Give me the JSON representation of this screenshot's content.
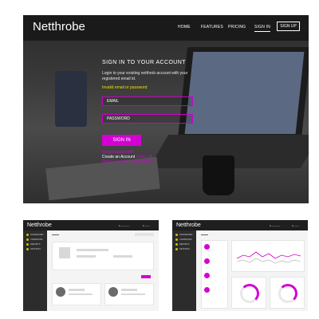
{
  "hero": {
    "brand": "Netthrobe",
    "nav": {
      "home": "HOME",
      "features": "FEATURES",
      "pricing": "PRICING",
      "sign_in": "SIGN IN",
      "sign_up": "SIGN UP"
    },
    "form": {
      "title": "SIGN IN TO YOUR ACCOUNT",
      "subtitle": "Login to your existing netthrob account with your registered email id.",
      "error": "Invalid email or password",
      "email_placeholder": "EMAIL",
      "password_placeholder": "PASSWORD",
      "sign_in_button": "SIGN IN",
      "forgot": "Forgot password?",
      "create_account": "Create an Account",
      "sign_up_link": "SIGN UP",
      "resend": "Didn't Receive confirmation?"
    }
  },
  "thumb1": {
    "brand": "Netthrobe",
    "sidebar": [
      "DASHBOARD",
      "CAMPAIGNS",
      "REPORTS",
      "SETTINGS"
    ]
  },
  "thumb2": {
    "brand": "Netthrobe",
    "sidebar": [
      "DASHBOARD",
      "CAMPAIGNS",
      "REPORTS",
      "SETTINGS"
    ]
  },
  "colors": {
    "accent": "#d400d4",
    "error": "#e8e000",
    "dark": "#1a1a1a"
  }
}
